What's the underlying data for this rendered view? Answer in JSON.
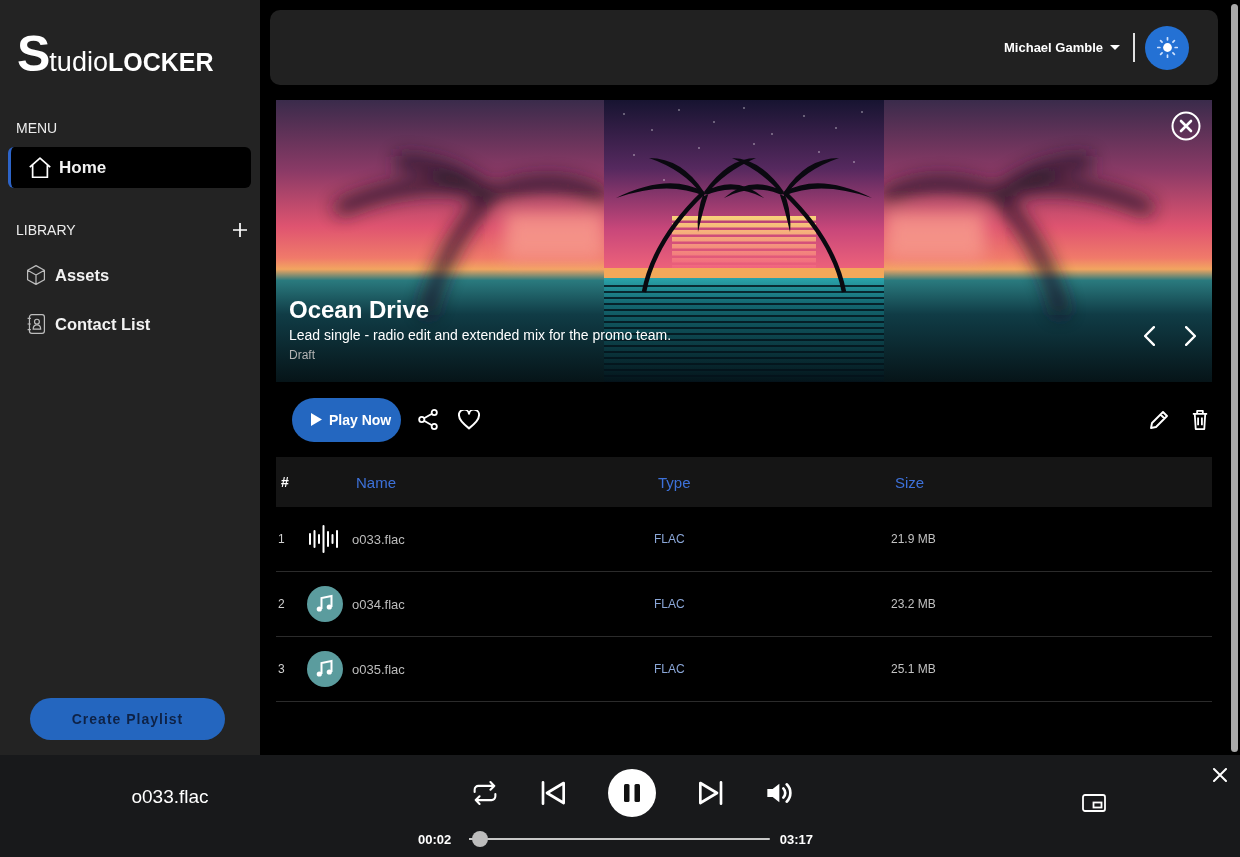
{
  "sidebar": {
    "logo": {
      "mark": "S",
      "light": "tudio",
      "bold": "LOCKER"
    },
    "menu_heading": "MENU",
    "menu_items": [
      {
        "label": "Home",
        "selected": true
      }
    ],
    "library_heading": "LIBRARY",
    "library_items": [
      {
        "label": "Assets",
        "selected": false
      },
      {
        "label": "Contact List",
        "selected": false
      }
    ],
    "create_button": "Create Playlist"
  },
  "top_bar": {
    "user_name": "Michael Gamble"
  },
  "hero": {
    "title": "Ocean Drive",
    "description": "Lead single - radio edit and extended mix for the promo team.",
    "status": "Draft"
  },
  "actions": {
    "play_button": "Play Now"
  },
  "table": {
    "columns": [
      "#",
      "Name",
      "Type",
      "Size"
    ],
    "rows": [
      {
        "number": "1",
        "name": "o033.flac",
        "type": "FLAC",
        "size": "21.9 MB",
        "playing": true
      },
      {
        "number": "2",
        "name": "o034.flac",
        "type": "FLAC",
        "size": "23.2 MB",
        "playing": false
      },
      {
        "number": "3",
        "name": "o035.flac",
        "type": "FLAC",
        "size": "25.1 MB",
        "playing": false
      }
    ]
  },
  "player": {
    "track": "o033.flac",
    "playing": true,
    "elapsed": "00:02",
    "level": 0.01,
    "duration": "03:17"
  }
}
